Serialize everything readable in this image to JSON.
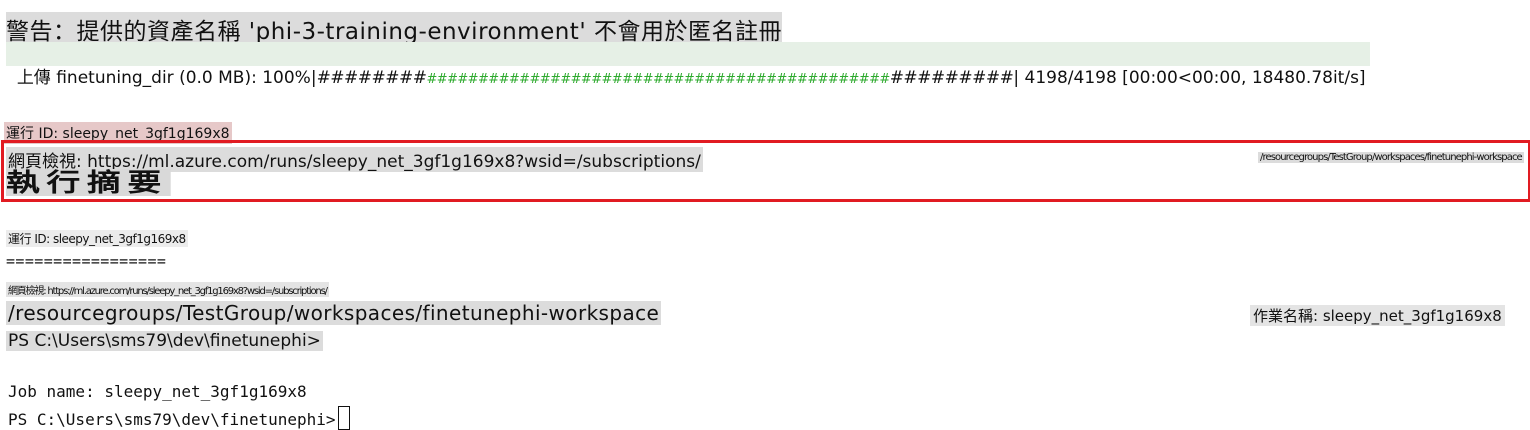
{
  "terminal": {
    "warning": "警告：提供的資產名稱 'phi-3-training-environment' 不會用於匿名註冊",
    "upload": {
      "prefix": "上傳 finetuning_dir (0.0 MB): 100%|",
      "bar_left": "########",
      "bar_green": "#############################################",
      "bar_right": "#########",
      "suffix": "| 4198/4198 [00:00<00:00, 18480.78it/s]",
      "progress_percent": 100
    },
    "run_id_top": "運行 ID: sleepy_net_3gf1g169x8",
    "web_view_1": "網頁檢視: https://ml.azure.com/runs/sleepy_net_3gf1g169x8?wsid=/subscriptions/",
    "resource_path_small": "/resourcegroups/TestGroup/workspaces/finetunephi-workspace",
    "execution_summary": "執行摘要",
    "run_id_mid": "運行 ID: sleepy_net_3gf1g169x8",
    "separator": "=================",
    "web_view_2": "網頁檢視: https://ml.azure.com/runs/sleepy_net_3gf1g169x8?wsid=/subscriptions/",
    "resource_path_large": "/resourcegroups/TestGroup/workspaces/finetunephi-workspace",
    "job_name_cn": "作業名稱: sleepy_net_3gf1g169x8",
    "prompt_1": "PS C:\\Users\\sms79\\dev\\finetunephi>",
    "job_name_en": "Job name: sleepy_net_3gf1g169x8",
    "prompt_2": "PS C:\\Users\\sms79\\dev\\finetunephi>"
  },
  "colors": {
    "highlight_border": "#e11b22",
    "progress_green": "#2eaa2e",
    "background": "#ffffff"
  }
}
